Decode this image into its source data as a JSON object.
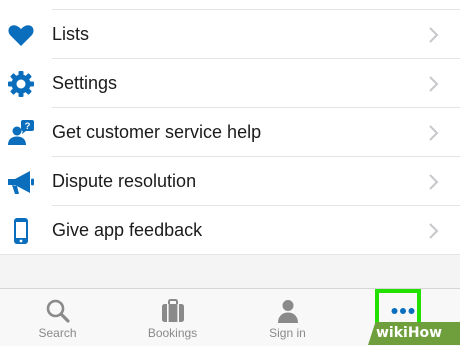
{
  "colors": {
    "accent": "#0a6ebd",
    "chevron": "#c7c7cc",
    "tab_inactive": "#8a8a8a",
    "highlight": "#22e100",
    "watermark_bg": "#6f9f3c"
  },
  "menu": {
    "items": [
      {
        "label": "Lists",
        "icon": "heart-icon"
      },
      {
        "label": "Settings",
        "icon": "gear-icon"
      },
      {
        "label": "Get customer service help",
        "icon": "customer-service-icon"
      },
      {
        "label": "Dispute resolution",
        "icon": "megaphone-icon"
      },
      {
        "label": "Give app feedback",
        "icon": "phone-icon"
      }
    ]
  },
  "tabbar": {
    "tabs": [
      {
        "label": "Search",
        "icon": "search-icon"
      },
      {
        "label": "Bookings",
        "icon": "briefcase-icon"
      },
      {
        "label": "Sign in",
        "icon": "person-icon"
      },
      {
        "label": "More",
        "icon": "more-dots-icon",
        "active": true
      }
    ]
  },
  "watermark": {
    "text": "wikiHow"
  }
}
